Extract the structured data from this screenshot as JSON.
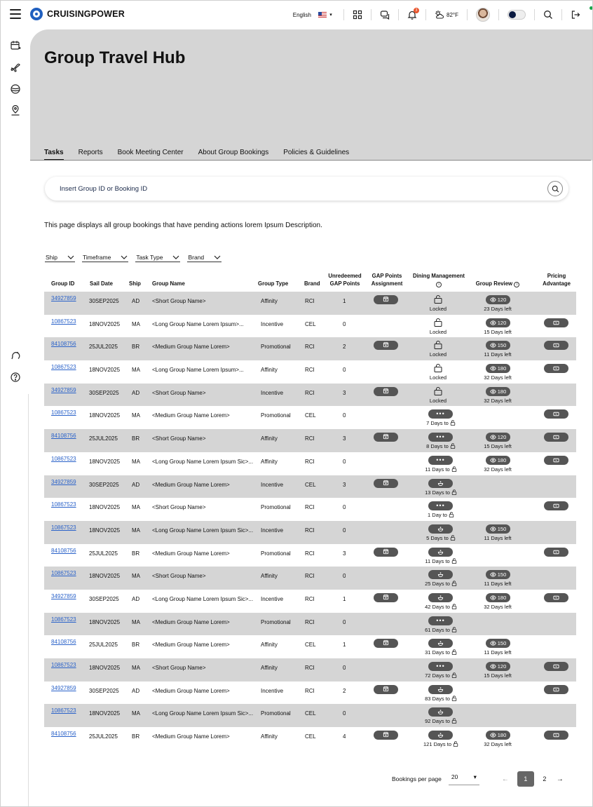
{
  "header": {
    "brand": "CRUISINGPOWER",
    "language": "English",
    "notification_count": "3",
    "temperature": "82°F"
  },
  "icons": {
    "menu": "hamburger-menu-icon",
    "apps": "grid-icon",
    "chat": "chat-icon",
    "bell": "bell-icon",
    "weather": "weather-icon",
    "search": "search-icon",
    "logout": "logout-icon"
  },
  "hero": {
    "title": "Group Travel Hub",
    "tabs": [
      "Tasks",
      "Reports",
      "Book Meeting Center",
      "About Group Bookings",
      "Policies & Guidelines"
    ],
    "active_tab": 0
  },
  "search": {
    "placeholder": "Insert Group ID or Booking ID"
  },
  "description": "This page displays all group bookings that have pending actions lorem Ipsum Description.",
  "filters": [
    "Ship",
    "Timeframe",
    "Task Type",
    "Brand"
  ],
  "table": {
    "columns": [
      "Group ID",
      "Sail Date",
      "Ship",
      "Group Name",
      "Group Type",
      "Brand",
      "Unredeemed GAP Points",
      "GAP Points Assignment",
      "Dining Management",
      "Group Review",
      "Pricing Advantage"
    ],
    "rows": [
      {
        "id": "34927859",
        "date": "30SEP2025",
        "ship": "AD",
        "name": "<Short Group Name>",
        "type": "Affinity",
        "brand": "RCI",
        "gap": "1",
        "assign": true,
        "dining": "locked",
        "dining_label": "Locked",
        "review": "120",
        "review_label": "23 Days left",
        "pricing": false
      },
      {
        "id": "10867523",
        "date": "18NOV2025",
        "ship": "MA",
        "name": "<Long Group Name Lorem Ipsum>...",
        "type": "Incentive",
        "brand": "CEL",
        "gap": "0",
        "assign": false,
        "dining": "locked",
        "dining_label": "Locked",
        "review": "120",
        "review_label": "15 Days left",
        "pricing": true
      },
      {
        "id": "84108756",
        "date": "25JUL2025",
        "ship": "BR",
        "name": "<Medium Group Name Lorem>",
        "type": "Promotional",
        "brand": "RCI",
        "gap": "2",
        "assign": true,
        "dining": "locked",
        "dining_label": "Locked",
        "review": "150",
        "review_label": "11 Days left",
        "pricing": true
      },
      {
        "id": "10867523",
        "date": "18NOV2025",
        "ship": "MA",
        "name": "<Long Group Name Lorem Ipsum>...",
        "type": "Affinity",
        "brand": "RCI",
        "gap": "0",
        "assign": false,
        "dining": "locked",
        "dining_label": "Locked",
        "review": "180",
        "review_label": "32 Days left",
        "pricing": true
      },
      {
        "id": "34927859",
        "date": "30SEP2025",
        "ship": "AD",
        "name": "<Short Group Name>",
        "type": "Incentive",
        "brand": "RCI",
        "gap": "3",
        "assign": true,
        "dining": "locked",
        "dining_label": "Locked",
        "review": "180",
        "review_label": "32 Days left",
        "pricing": false
      },
      {
        "id": "10867523",
        "date": "18NOV2025",
        "ship": "MA",
        "name": "<Medium Group Name Lorem>",
        "type": "Promotional",
        "brand": "CEL",
        "gap": "0",
        "assign": false,
        "dining": "dots",
        "dining_label": "7 Days to",
        "review": "",
        "review_label": "",
        "pricing": true
      },
      {
        "id": "84108756",
        "date": "25JUL2025",
        "ship": "BR",
        "name": "<Short Group Name>",
        "type": "Affinity",
        "brand": "RCI",
        "gap": "3",
        "assign": true,
        "dining": "dots",
        "dining_label": "8 Days to",
        "review": "120",
        "review_label": "15 Days left",
        "pricing": true
      },
      {
        "id": "10867523",
        "date": "18NOV2025",
        "ship": "MA",
        "name": "<Long Group Name Lorem Ipsum Sic>...",
        "type": "Affinity",
        "brand": "RCI",
        "gap": "0",
        "assign": false,
        "dining": "dots",
        "dining_label": "11 Days to",
        "review": "180",
        "review_label": "32 Days left",
        "pricing": true
      },
      {
        "id": "34927859",
        "date": "30SEP2025",
        "ship": "AD",
        "name": "<Medium Group Name Lorem>",
        "type": "Incentive",
        "brand": "CEL",
        "gap": "3",
        "assign": true,
        "dining": "dish",
        "dining_label": "13 Days to",
        "review": "",
        "review_label": "",
        "pricing": false
      },
      {
        "id": "10867523",
        "date": "18NOV2025",
        "ship": "MA",
        "name": "<Short Group Name>",
        "type": "Promotional",
        "brand": "RCI",
        "gap": "0",
        "assign": false,
        "dining": "dots",
        "dining_label": "1 Day to",
        "review": "",
        "review_label": "",
        "pricing": true
      },
      {
        "id": "10867523",
        "date": "18NOV2025",
        "ship": "MA",
        "name": "<Long Group Name Lorem Ipsum Sic>...",
        "type": "Incentive",
        "brand": "RCI",
        "gap": "0",
        "assign": false,
        "dining": "dish",
        "dining_label": "5 Days to",
        "review": "150",
        "review_label": "11 Days left",
        "pricing": false
      },
      {
        "id": "84108756",
        "date": "25JUL2025",
        "ship": "BR",
        "name": "<Medium Group Name Lorem>",
        "type": "Promotional",
        "brand": "RCI",
        "gap": "3",
        "assign": true,
        "dining": "dish",
        "dining_label": "11 Days to",
        "review": "",
        "review_label": "",
        "pricing": true
      },
      {
        "id": "10867523",
        "date": "18NOV2025",
        "ship": "MA",
        "name": "<Short Group Name>",
        "type": "Affinity",
        "brand": "RCI",
        "gap": "0",
        "assign": false,
        "dining": "dish",
        "dining_label": "25 Days to",
        "review": "150",
        "review_label": "11 Days left",
        "pricing": false
      },
      {
        "id": "34927859",
        "date": "30SEP2025",
        "ship": "AD",
        "name": "<Long Group Name Lorem Ipsum Sic>...",
        "type": "Incentive",
        "brand": "RCI",
        "gap": "1",
        "assign": true,
        "dining": "dish",
        "dining_label": "42 Days to",
        "review": "180",
        "review_label": "32 Days left",
        "pricing": true
      },
      {
        "id": "10867523",
        "date": "18NOV2025",
        "ship": "MA",
        "name": "<Medium Group Name Lorem>",
        "type": "Promotional",
        "brand": "RCI",
        "gap": "0",
        "assign": false,
        "dining": "dots",
        "dining_label": "61 Days to",
        "review": "",
        "review_label": "",
        "pricing": false
      },
      {
        "id": "84108756",
        "date": "25JUL2025",
        "ship": "BR",
        "name": "<Medium Group Name Lorem>",
        "type": "Affinity",
        "brand": "CEL",
        "gap": "1",
        "assign": true,
        "dining": "dish",
        "dining_label": "31 Days to",
        "review": "150",
        "review_label": "11 Days left",
        "pricing": false
      },
      {
        "id": "10867523",
        "date": "18NOV2025",
        "ship": "MA",
        "name": "<Short Group Name>",
        "type": "Affinity",
        "brand": "RCI",
        "gap": "0",
        "assign": false,
        "dining": "dots",
        "dining_label": "72 Days to",
        "review": "120",
        "review_label": "15 Days left",
        "pricing": true
      },
      {
        "id": "34927859",
        "date": "30SEP2025",
        "ship": "AD",
        "name": "<Medium Group Name Lorem>",
        "type": "Incentive",
        "brand": "RCI",
        "gap": "2",
        "assign": true,
        "dining": "dish",
        "dining_label": "83 Days to",
        "review": "",
        "review_label": "",
        "pricing": true
      },
      {
        "id": "10867523",
        "date": "18NOV2025",
        "ship": "MA",
        "name": "<Long Group Name Lorem Ipsum Sic>...",
        "type": "Promotional",
        "brand": "CEL",
        "gap": "0",
        "assign": false,
        "dining": "dish",
        "dining_label": "92 Days to",
        "review": "",
        "review_label": "",
        "pricing": false
      },
      {
        "id": "84108756",
        "date": "25JUL2025",
        "ship": "BR",
        "name": "<Medium Group Name Lorem>",
        "type": "Affinity",
        "brand": "CEL",
        "gap": "4",
        "assign": true,
        "dining": "dish",
        "dining_label": "121 Days to",
        "review": "180",
        "review_label": "32 Days left",
        "pricing": true
      }
    ]
  },
  "pagination": {
    "per_page_label": "Bookings per page",
    "per_page_value": "20",
    "pages": [
      "1",
      "2"
    ],
    "current_page": "1"
  },
  "colors": {
    "accent_blue": "#1f5fbf",
    "link": "#2a62c9",
    "hero_bg": "#d5d5d5",
    "pill": "#555555"
  }
}
